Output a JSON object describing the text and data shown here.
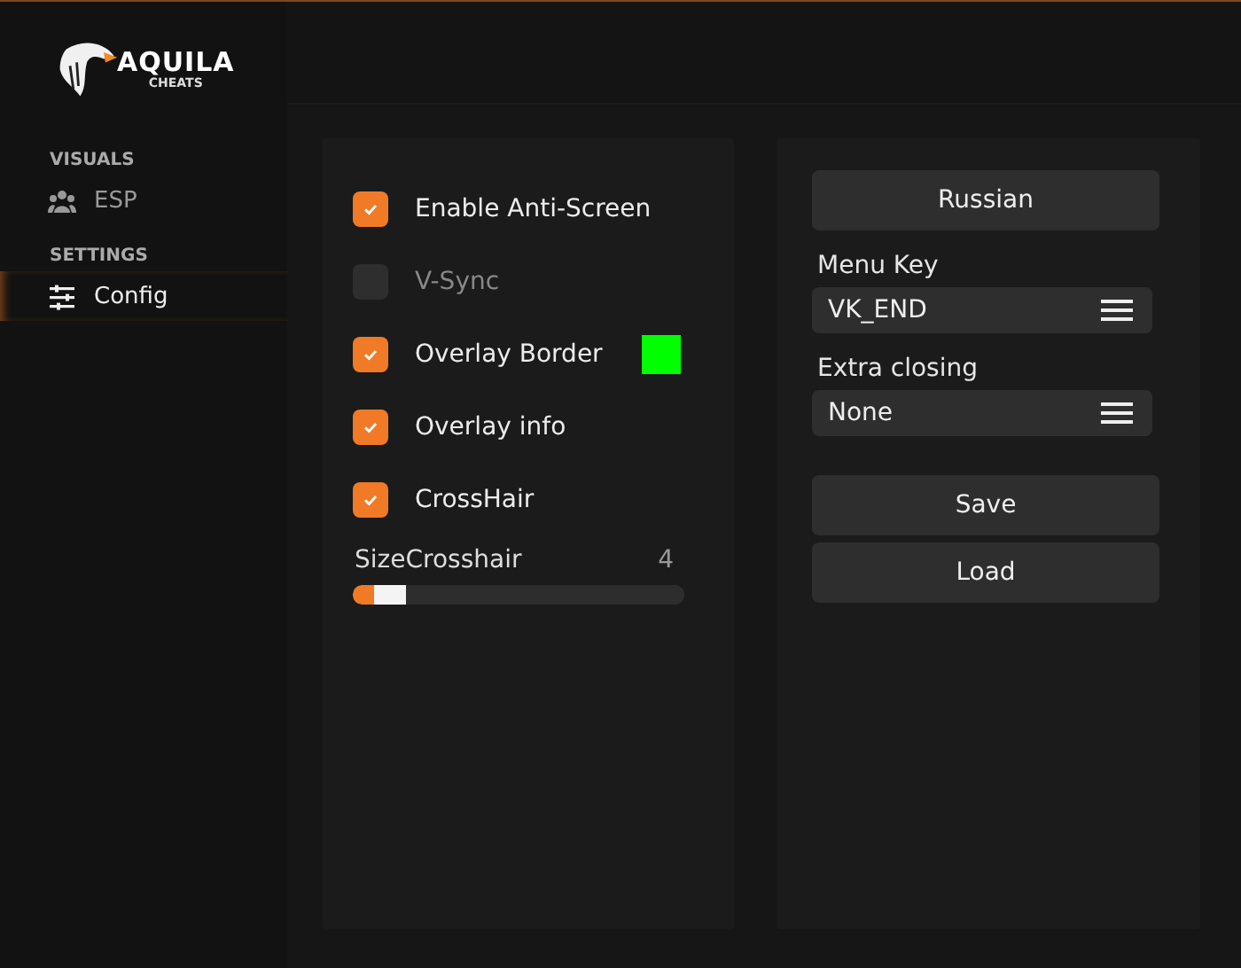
{
  "logo": {
    "title": "AQUILA",
    "subtitle": "CHEATS"
  },
  "sidebar": {
    "sections": [
      {
        "heading": "VISUALS",
        "items": [
          {
            "label": "ESP",
            "selected": false
          }
        ]
      },
      {
        "heading": "SETTINGS",
        "items": [
          {
            "label": "Config",
            "selected": true
          }
        ]
      }
    ]
  },
  "left_panel": {
    "options": [
      {
        "label": "Enable Anti-Screen",
        "checked": true
      },
      {
        "label": "V-Sync",
        "checked": false
      },
      {
        "label": "Overlay Border",
        "checked": true,
        "color": "#00ff00"
      },
      {
        "label": "Overlay info",
        "checked": true
      },
      {
        "label": "CrossHair",
        "checked": true
      }
    ],
    "slider": {
      "label": "SizeCrosshair",
      "reading": "4",
      "level": 0.16
    }
  },
  "right_panel": {
    "items": [
      {
        "kind": "button",
        "label": "Russian"
      },
      {
        "kind": "select",
        "label": "Menu Key",
        "value": "VK_END"
      },
      {
        "kind": "select",
        "label": "Extra closing",
        "value": "None"
      },
      {
        "kind": "button",
        "label": "Save"
      },
      {
        "kind": "button",
        "label": "Load"
      }
    ]
  }
}
